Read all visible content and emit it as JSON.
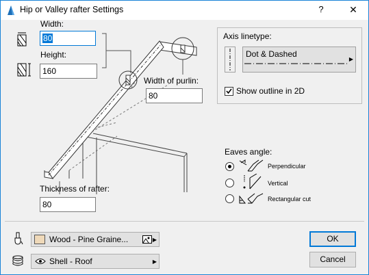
{
  "window": {
    "title": "Hip or Valley rafter Settings",
    "help_label": "?",
    "close_label": "✕"
  },
  "dimensions": {
    "width_label": "Width:",
    "width_value": "80",
    "height_label": "Height:",
    "height_value": "160",
    "purlin_label": "Width of purlin:",
    "purlin_value": "80",
    "thickness_label": "Thickness of rafter:",
    "thickness_value": "80"
  },
  "axis": {
    "group_label": "Axis linetype:",
    "linetype_name": "Dot & Dashed",
    "show_outline_label": "Show outline in 2D",
    "show_outline_checked": true
  },
  "eaves": {
    "label": "Eaves angle:",
    "options": [
      {
        "label": "Perpendicular",
        "selected": true
      },
      {
        "label": "Vertical",
        "selected": false
      },
      {
        "label": "Rectangular cut",
        "selected": false
      }
    ]
  },
  "material": {
    "surface_name": "Wood - Pine Graine...",
    "surface_swatch_color": "#efd9b9",
    "layer_name": "Shell - Roof"
  },
  "buttons": {
    "ok": "OK",
    "cancel": "Cancel"
  },
  "colors": {
    "accent": "#0078d7",
    "window_border": "#1883d7"
  }
}
